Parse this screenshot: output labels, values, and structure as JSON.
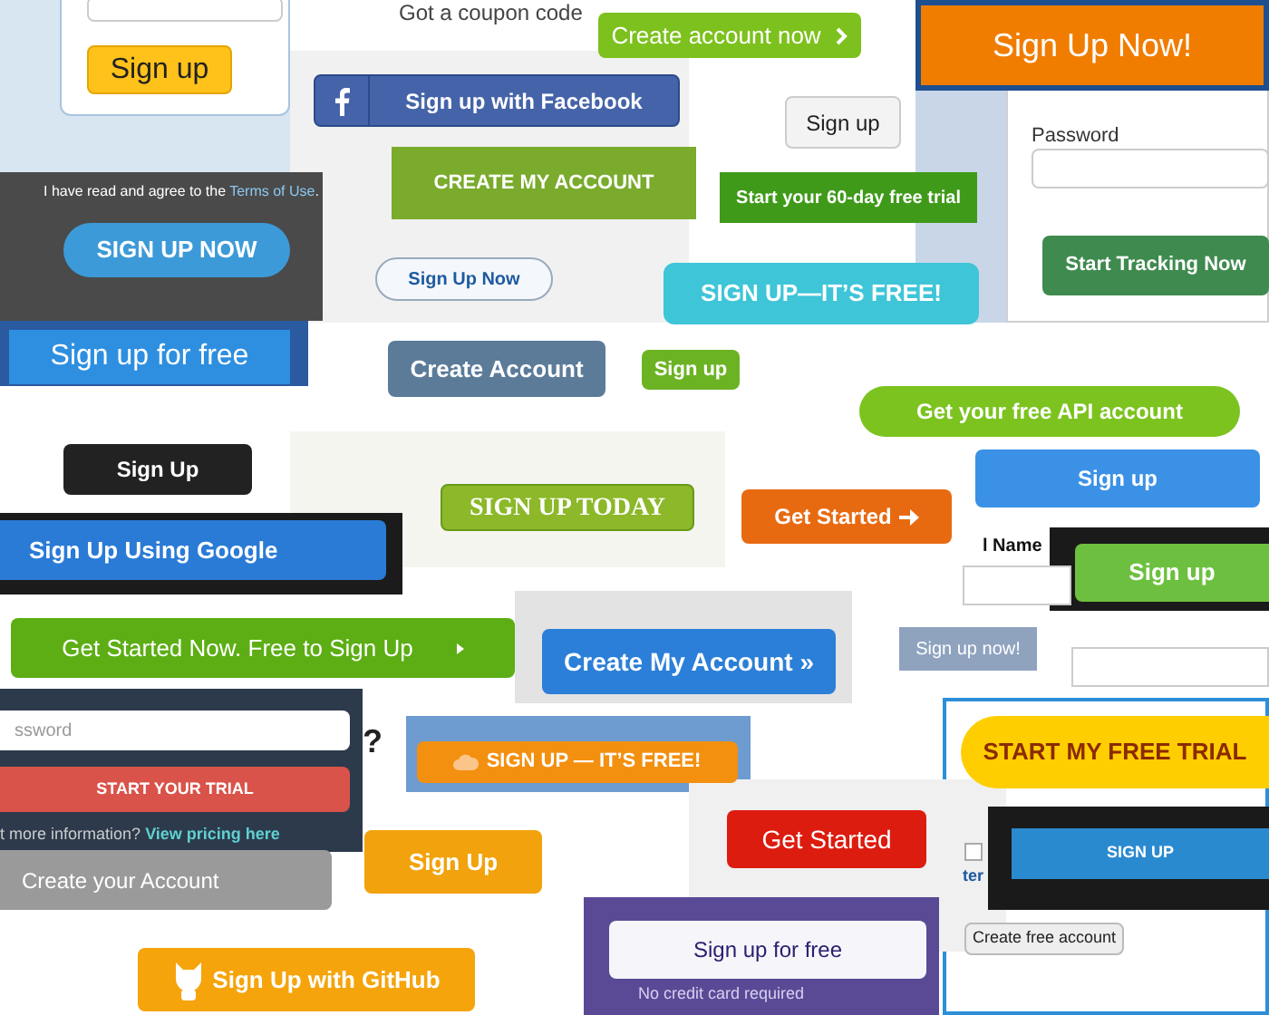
{
  "items": [
    {
      "kind": "field"
    },
    {
      "kind": "button",
      "label": "Sign up"
    },
    {
      "kind": "text",
      "text": "Got a coupon code"
    },
    {
      "kind": "button",
      "label": "Create account now"
    },
    {
      "kind": "button",
      "label": "Sign up with Facebook"
    },
    {
      "kind": "button",
      "label": "Sign up"
    },
    {
      "kind": "button",
      "label": "Sign Up Now!"
    },
    {
      "kind": "text",
      "text": "Password"
    },
    {
      "kind": "field"
    },
    {
      "kind": "button",
      "label": "Start Tracking Now"
    },
    {
      "kind": "note",
      "text": "I have read and agree to the",
      "link": "Terms of Use",
      "tail": "."
    },
    {
      "kind": "button",
      "label": "CREATE MY ACCOUNT"
    },
    {
      "kind": "button",
      "label": "Start your 60-day free trial"
    },
    {
      "kind": "button",
      "label": "SIGN UP NOW"
    },
    {
      "kind": "button",
      "label": "Sign Up Now"
    },
    {
      "kind": "button",
      "label": "SIGN UP—IT’S FREE!"
    },
    {
      "kind": "button",
      "label": "Sign up for free"
    },
    {
      "kind": "button",
      "label": "Create Account"
    },
    {
      "kind": "button",
      "label": "Sign up"
    },
    {
      "kind": "button",
      "label": "Get your free API account"
    },
    {
      "kind": "button",
      "label": "Sign Up"
    },
    {
      "kind": "button",
      "label": "SIGN UP TODAY"
    },
    {
      "kind": "button",
      "label": "Get Started"
    },
    {
      "kind": "button",
      "label": "Sign up"
    },
    {
      "kind": "text",
      "text": "l Name"
    },
    {
      "kind": "field"
    },
    {
      "kind": "button",
      "label": "Sign up"
    },
    {
      "kind": "button",
      "label": "Sign Up Using Google"
    },
    {
      "kind": "button",
      "label": "Get Started Now. Free to Sign Up"
    },
    {
      "kind": "button",
      "label": "Create My Account »"
    },
    {
      "kind": "button",
      "label": "Sign up now!"
    },
    {
      "kind": "field"
    },
    {
      "kind": "field",
      "placeholder": "ssword"
    },
    {
      "kind": "button",
      "label": "START YOUR TRIAL"
    },
    {
      "kind": "note",
      "text": "t more information?",
      "link": "View pricing here"
    },
    {
      "kind": "text",
      "text": "?"
    },
    {
      "kind": "button",
      "label": "SIGN UP — IT’S FREE!"
    },
    {
      "kind": "button",
      "label": "Create your Account"
    },
    {
      "kind": "button",
      "label": "Sign Up"
    },
    {
      "kind": "button",
      "label": "Sign Up with GitHub"
    },
    {
      "kind": "button",
      "label": "Get Started"
    },
    {
      "kind": "button",
      "label": "Sign up for free"
    },
    {
      "kind": "text",
      "text": "No credit card required"
    },
    {
      "kind": "button",
      "label": "START MY FREE TRIAL"
    },
    {
      "kind": "checkbox",
      "checked": false
    },
    {
      "kind": "text",
      "text": "ter"
    },
    {
      "kind": "button",
      "label": "SIGN UP"
    },
    {
      "kind": "button",
      "label": "Create free account"
    }
  ]
}
